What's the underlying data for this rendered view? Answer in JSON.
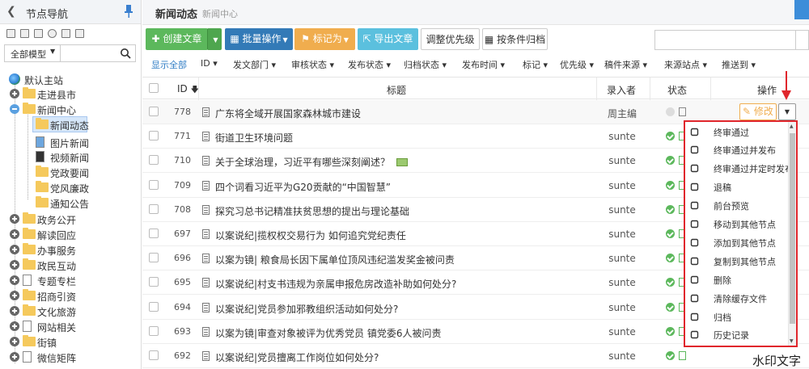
{
  "sidebar": {
    "title": "节点导航",
    "model_select": "全部模型",
    "tree": [
      {
        "label": "默认主站",
        "type": "site"
      },
      {
        "label": "走进县市",
        "type": "folder",
        "expand": "plus"
      },
      {
        "label": "新闻中心",
        "type": "folder",
        "expand": "minus"
      },
      {
        "label": "新闻动态",
        "type": "folder",
        "selected": true
      },
      {
        "label": "图片新闻",
        "type": "image"
      },
      {
        "label": "视频新闻",
        "type": "video"
      },
      {
        "label": "党政要闻",
        "type": "folder"
      },
      {
        "label": "党风廉政",
        "type": "folder"
      },
      {
        "label": "通知公告",
        "type": "folder"
      },
      {
        "label": "政务公开",
        "type": "folder",
        "expand": "plus"
      },
      {
        "label": "解读回应",
        "type": "folder",
        "expand": "plus"
      },
      {
        "label": "办事服务",
        "type": "folder",
        "expand": "plus"
      },
      {
        "label": "政民互动",
        "type": "folder",
        "expand": "plus"
      },
      {
        "label": "专题专栏",
        "type": "doc",
        "expand": "plus"
      },
      {
        "label": "招商引资",
        "type": "folder",
        "expand": "plus"
      },
      {
        "label": "文化旅游",
        "type": "folder",
        "expand": "plus"
      },
      {
        "label": "网站相关",
        "type": "doc",
        "expand": "plus"
      },
      {
        "label": "街镇",
        "type": "folder",
        "expand": "plus"
      },
      {
        "label": "微信矩阵",
        "type": "doc",
        "expand": "plus"
      }
    ]
  },
  "header": {
    "title": "新闻动态",
    "crumb": "新闻中心"
  },
  "toolbar": {
    "create": "创建文章",
    "batch": "批量操作",
    "mark": "标记为",
    "export": "导出文章",
    "priority": "调整优先级",
    "archive": "按条件归档"
  },
  "search": {
    "value": "",
    "placeholder": ""
  },
  "filters": [
    "显示全部",
    "ID",
    "发文部门",
    "审核状态",
    "发布状态",
    "归档状态",
    "发布时间",
    "标记",
    "优先级",
    "稿件来源",
    "来源站点",
    "推送到"
  ],
  "table": {
    "headers": {
      "id": "ID",
      "title": "标题",
      "author": "录入者",
      "status": "状态",
      "op": "操作"
    },
    "rows": [
      {
        "id": "778",
        "title": "广东将全域开展国家森林城市建设",
        "author": "周主编",
        "status": "pending"
      },
      {
        "id": "771",
        "title": "街道卫生环境问题",
        "author": "sunte",
        "status": "ok"
      },
      {
        "id": "710",
        "title": "关于全球治理，习近平有哪些深刻阐述？",
        "author": "sunte",
        "status": "ok",
        "thumb": true
      },
      {
        "id": "709",
        "title": "四个词看习近平为G20贡献的“中国智慧”",
        "author": "sunte",
        "status": "ok"
      },
      {
        "id": "708",
        "title": "探究习总书记精准扶贫思想的提出与理论基础",
        "author": "sunte",
        "status": "ok"
      },
      {
        "id": "697",
        "title": "以案说纪|揽权权交易行为 如何追究党纪责任",
        "author": "sunte",
        "status": "ok"
      },
      {
        "id": "696",
        "title": "以案为镜| 粮食局长因下属单位顶风违纪滥发奖金被问责",
        "author": "sunte",
        "status": "ok"
      },
      {
        "id": "695",
        "title": "以案说纪|村支书违规为亲属申报危房改造补助如何处分?",
        "author": "sunte",
        "status": "ok"
      },
      {
        "id": "694",
        "title": "以案说纪|党员参加邪教组织活动如何处分?",
        "author": "sunte",
        "status": "ok"
      },
      {
        "id": "693",
        "title": "以案为镜|审查对象被评为优秀党员 镇党委6人被问责",
        "author": "sunte",
        "status": "ok"
      },
      {
        "id": "692",
        "title": "以案说纪|党员擅离工作岗位如何处分?",
        "author": "sunte",
        "status": "ok"
      }
    ],
    "edit_label": "修改"
  },
  "menu": [
    {
      "label": "终审通过",
      "icon": "stamp-icon"
    },
    {
      "label": "终审通过并发布",
      "icon": "stamp-publish-icon"
    },
    {
      "label": "终审通过并定时发布",
      "icon": "clock-icon"
    },
    {
      "label": "退稿",
      "icon": "return-icon"
    },
    {
      "label": "前台预览",
      "icon": "preview-icon"
    },
    {
      "label": "移动到其他节点",
      "icon": "move-icon"
    },
    {
      "label": "添加到其他节点",
      "icon": "plus-icon"
    },
    {
      "label": "复制到其他节点",
      "icon": "copy-icon"
    },
    {
      "label": "删除",
      "icon": "trash-icon"
    },
    {
      "label": "清除缓存文件",
      "icon": "clear-cache-icon"
    },
    {
      "label": "归档",
      "icon": "archive-icon"
    },
    {
      "label": "历史记录",
      "icon": "history-icon"
    }
  ],
  "watermark": "水印文字",
  "colors": {
    "accent": "#337ab7",
    "success": "#5cb85c",
    "warning": "#f0ad4e",
    "info": "#5bc0de",
    "highlight": "#e0262c"
  }
}
